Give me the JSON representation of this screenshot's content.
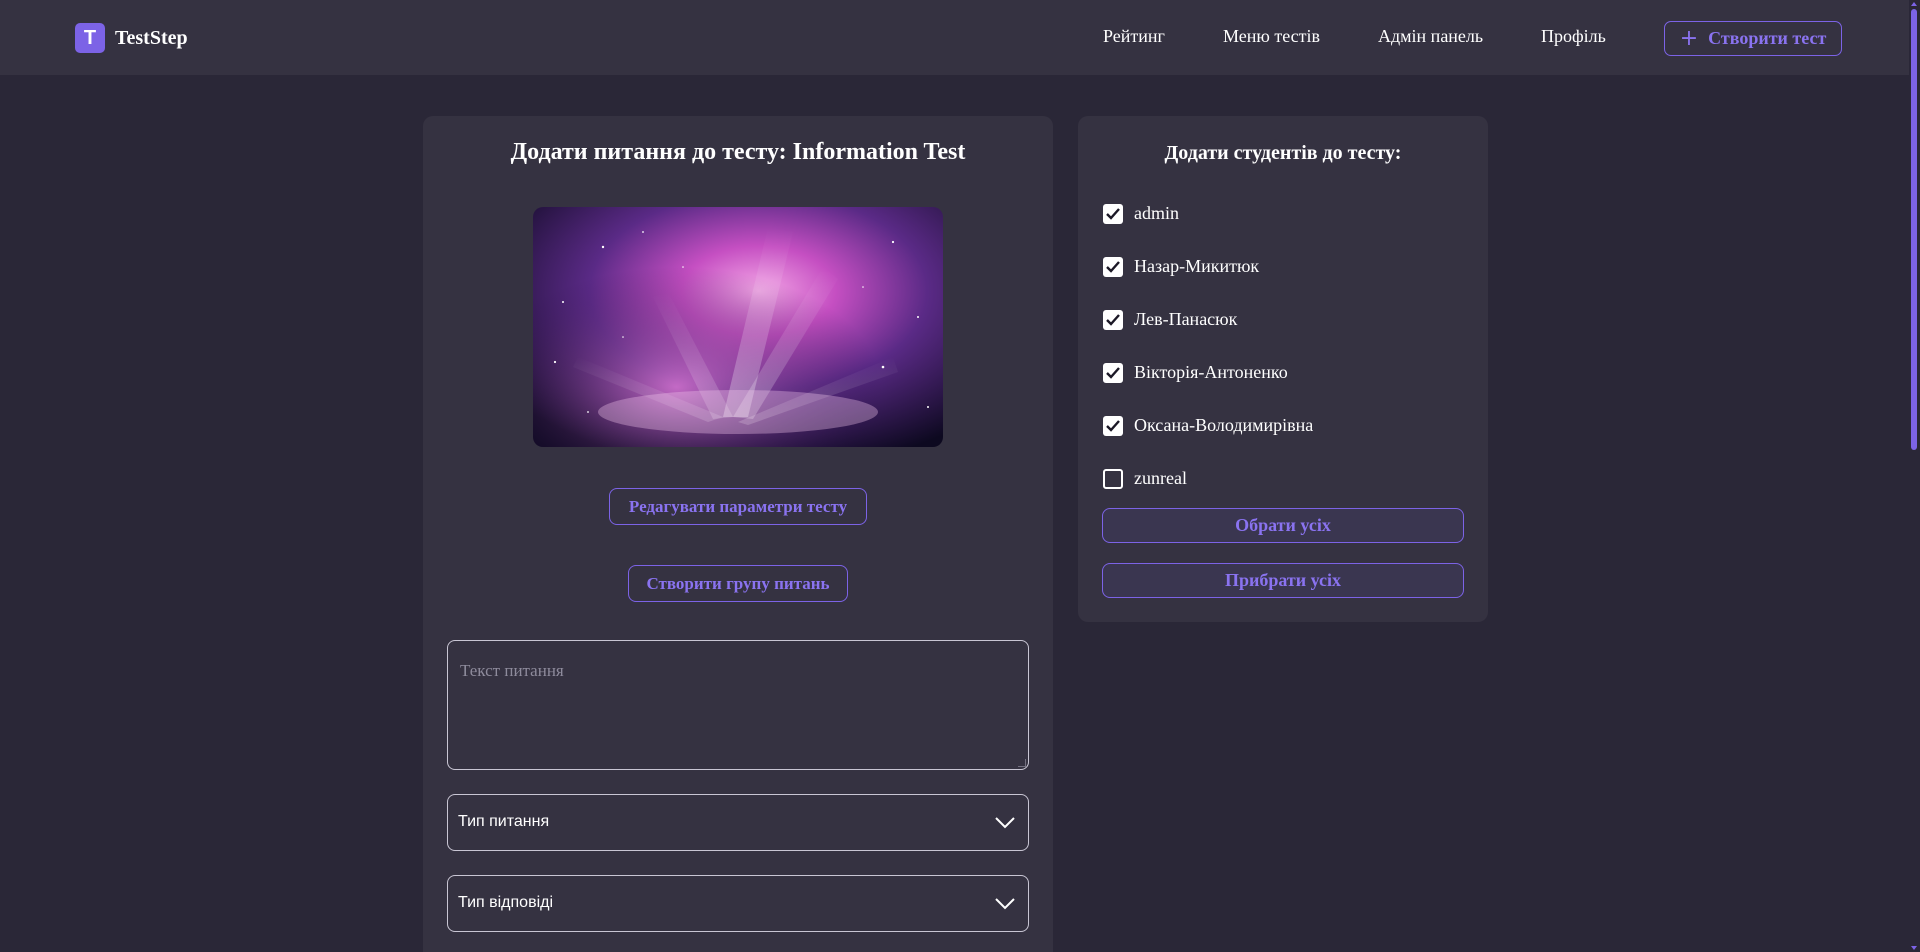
{
  "header": {
    "logo_letter": "T",
    "logo_text": "TestStep",
    "nav": {
      "rating": "Рейтинг",
      "tests_menu": "Меню тестів",
      "admin_panel": "Адмін панель",
      "profile": "Профіль"
    },
    "create_test_label": "Створити тест",
    "create_test_icon": "plus-icon"
  },
  "editor": {
    "title": "Додати питання до тесту: Information Test",
    "edit_params_label": "Редагувати параметри тесту",
    "create_group_label": "Створити групу питань",
    "question_text_placeholder": "Текст питання",
    "question_type_value": "Тип питання",
    "answer_type_value": "Тип відповіді"
  },
  "students": {
    "title": "Додати студентів до тесту:",
    "list": [
      {
        "name": "admin",
        "checked": true
      },
      {
        "name": "Назар-Микитюк",
        "checked": true
      },
      {
        "name": "Лев-Панасюк",
        "checked": true
      },
      {
        "name": "Вікторія-Антоненко",
        "checked": true
      },
      {
        "name": "Оксана-Володимирівна",
        "checked": true
      },
      {
        "name": "zunreal",
        "checked": false
      }
    ],
    "select_all_label": "Обрати усіх",
    "remove_all_label": "Прибрати усіх"
  },
  "colors": {
    "page_bg": "#2a2737",
    "panel_bg": "#353241",
    "accent": "#7c63e6",
    "accent_text": "#8a73f0"
  }
}
